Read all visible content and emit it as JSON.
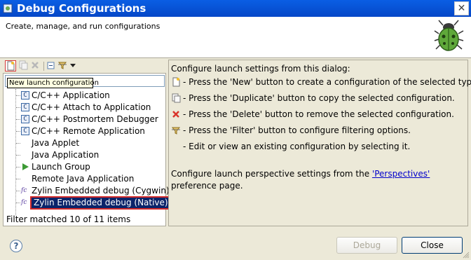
{
  "window": {
    "title": "Debug Configurations"
  },
  "header": {
    "subtitle": "Create, manage, and run configurations"
  },
  "tooltip": {
    "text": "New launch configuration"
  },
  "tree": {
    "items": [
      {
        "label": "C/C++ Application",
        "icon": "c-icon"
      },
      {
        "label": "C/C++ Attach to Application",
        "icon": "c-icon"
      },
      {
        "label": "C/C++ Postmortem Debugger",
        "icon": "c-icon"
      },
      {
        "label": "C/C++ Remote Application",
        "icon": "c-icon"
      },
      {
        "label": "Java Applet",
        "icon": "none"
      },
      {
        "label": "Java Application",
        "icon": "none"
      },
      {
        "label": "Launch Group",
        "icon": "play-icon"
      },
      {
        "label": "Remote Java Application",
        "icon": "none"
      },
      {
        "label": "Zylin Embedded debug (Cygwin)",
        "icon": "fc-icon"
      },
      {
        "label": "Zylin Embedded debug (Native)",
        "icon": "fc-icon"
      }
    ],
    "filter_status": "Filter matched 10 of 11 items"
  },
  "right": {
    "intro": "Configure launch settings from this dialog:",
    "instructions": [
      "- Press the 'New' button to create a configuration of the selected type.",
      "- Press the 'Duplicate' button to copy the selected configuration.",
      "- Press the 'Delete' button to remove the selected configuration.",
      "- Press the 'Filter' button to configure filtering options.",
      "- Edit or view an existing configuration by selecting it."
    ],
    "persp_before": "Configure launch perspective settings from the ",
    "persp_link": "'Perspectives'",
    "persp_after": " preference page."
  },
  "buttons": {
    "help": "?",
    "debug": "Debug",
    "close": "Close"
  },
  "colors": {
    "titlebar": "#0a5ee4",
    "selection": "#0a246a",
    "link": "#0000cc",
    "highlight_outline": "#d22a2a"
  }
}
